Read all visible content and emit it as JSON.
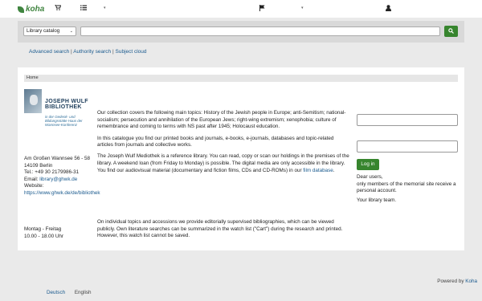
{
  "navbar": {
    "logo": "koha",
    "cart_icon": "cart-icon",
    "lists_icon": "list-icon",
    "flag_icon": "flag-icon",
    "user_icon": "user-icon",
    "caret": "▾"
  },
  "search": {
    "select_value": "Library catalog",
    "input_value": "",
    "button_icon": "search-icon"
  },
  "links": {
    "advanced": "Advanced search",
    "authority": "Authority search",
    "subject": "Subject cloud",
    "sep": "|"
  },
  "breadcrumb": {
    "home": "Home"
  },
  "library_logo": {
    "line1": "JOSEPH WULF",
    "line2": "BIBLIOTHEK",
    "sub": "in der Gedenk- und Bildungsstätte Haus der Wannsee-Konferenz"
  },
  "address": {
    "line1": "Am Großen Wannsee 56 - 58",
    "line2": "14109 Berlin",
    "tel": "Tel.: +49 30 2179986-31",
    "email_label": "Email:",
    "email": "library@ghwk.de",
    "website_label": "Website:",
    "website": "https://www.ghwk.de/de/bibliothek"
  },
  "hours": {
    "days": "Montag - Freitag",
    "time": "10.00 - 18.00 Uhr"
  },
  "content": {
    "p1": "Our collection covers the following main topics: History of the Jewish people in Europe; anti-Semitism; national-socialism; persecution and annihilation of the European Jews; right-wing extremism; xenophobia; culture of remembrance and coming to terms with NS past after 1945; Holocaust education.",
    "p2": "In this catalogue you find our printed books and journals, e-books, e-journals, databases and topic-related articles from journals and collective works.",
    "p3_a": "The Joseph Wulf Mediothek is a reference library. You can read, copy or scan our holdings in the premises of the library. A weekend loan (from Friday to Monday) is possible. The digital media are only accessible in the library. You find our audiovisual material (documentary and fiction films, CDs and CD-ROMs) in our ",
    "p3_link": "film database",
    "p3_b": ".",
    "p4": "On individual topics and accessions we provide editorially supervised bibliographies, which can be viewed publicly. Own literature searches can be summarized in the watch list (\"Cart\") during the research and printed. However, this watch list cannot be saved."
  },
  "login": {
    "username_value": "",
    "password_value": "",
    "button": "Log in",
    "note1": "Dear users,",
    "note2": "only members of the memorial site receive a personal account.",
    "note3": "Your library team."
  },
  "footer": {
    "powered_by": "Powered by",
    "koha": "Koha",
    "lang_active": "Deutsch",
    "lang_other": "English"
  },
  "colors": {
    "brand_green": "#37852e",
    "link_blue": "#1a5a8e"
  }
}
